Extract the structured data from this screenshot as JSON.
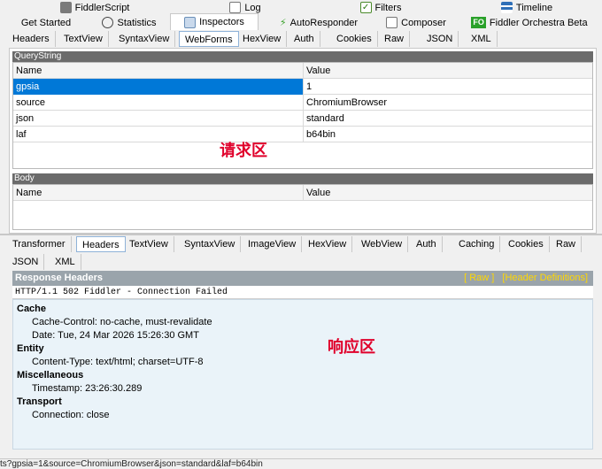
{
  "top_tabs_row1": [
    {
      "label": "FiddlerScript",
      "icon": "script-icon"
    },
    {
      "label": "Log",
      "icon": "log-icon"
    },
    {
      "label": "Filters",
      "icon": "checkbox-icon"
    },
    {
      "label": "Timeline",
      "icon": "timeline-icon"
    }
  ],
  "top_tabs_row2": [
    {
      "label": "Get Started",
      "icon": ""
    },
    {
      "label": "Statistics",
      "icon": "stopwatch-icon"
    },
    {
      "label": "Inspectors",
      "icon": "inspectors-icon"
    },
    {
      "label": "AutoResponder",
      "icon": "lightning-icon"
    },
    {
      "label": "Composer",
      "icon": "composer-icon"
    },
    {
      "label": "Fiddler Orchestra Beta",
      "icon": "fo-icon",
      "icon_text": "FO"
    }
  ],
  "request_tabs": [
    "Headers",
    "TextView",
    "SyntaxView",
    "WebForms",
    "HexView",
    "Auth",
    "Cookies",
    "Raw",
    "JSON",
    "XML"
  ],
  "request_active_tab": "WebForms",
  "querystring": {
    "title": "QueryString",
    "columns": [
      "Name",
      "Value"
    ],
    "rows": [
      {
        "name": "gpsia",
        "value": "1"
      },
      {
        "name": "source",
        "value": "ChromiumBrowser"
      },
      {
        "name": "json",
        "value": "standard"
      },
      {
        "name": "laf",
        "value": "b64bin"
      }
    ]
  },
  "annotation_request": "请求区",
  "body_section": {
    "title": "Body",
    "columns": [
      "Name",
      "Value"
    ]
  },
  "response_tabs_row1": [
    "Transformer",
    "Headers",
    "TextView",
    "SyntaxView",
    "ImageView",
    "HexView",
    "WebView",
    "Auth",
    "Caching",
    "Cookies",
    "Raw"
  ],
  "response_tabs_row2": [
    "JSON",
    "XML"
  ],
  "response_active_tab": "Headers",
  "response_headers": {
    "title": "Response Headers",
    "link_raw": "[ Raw ]",
    "link_defs": "[Header Definitions]",
    "status_line": "HTTP/1.1 502 Fiddler - Connection Failed",
    "groups": [
      {
        "name": "Cache",
        "items": [
          "Cache-Control: no-cache, must-revalidate",
          "Date: Tue, 24 Mar 2026 15:26:30 GMT"
        ]
      },
      {
        "name": "Entity",
        "items": [
          "Content-Type: text/html; charset=UTF-8"
        ]
      },
      {
        "name": "Miscellaneous",
        "items": [
          "Timestamp: 23:26:30.289"
        ]
      },
      {
        "name": "Transport",
        "items": [
          "Connection: close"
        ]
      }
    ]
  },
  "annotation_response": "响应区",
  "status_bar": "ts?gpsia=1&source=ChromiumBrowser&json=standard&laf=b64bin",
  "colors": {
    "selected_row": "#0078d7",
    "annotation": "#e0002b",
    "response_bar": "#9aa4ab",
    "header_links": "#ffd700"
  }
}
